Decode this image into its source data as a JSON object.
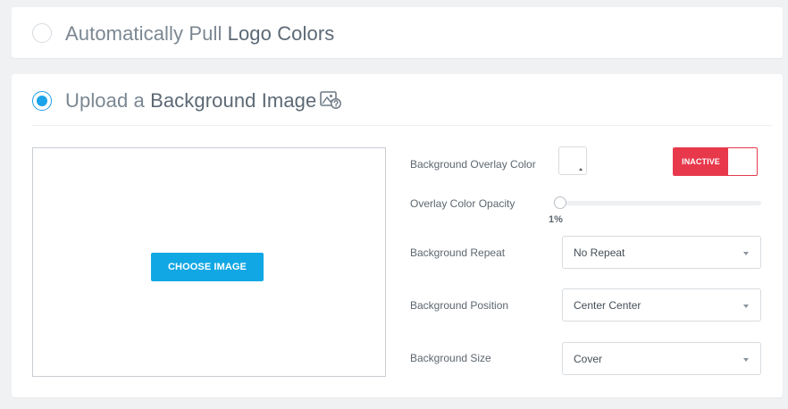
{
  "auto_pull": {
    "label_prefix": "Automatically Pull ",
    "label_bold": "Logo Colors",
    "selected": false
  },
  "upload": {
    "label_prefix": "Upload a ",
    "label_bold": "Background Image",
    "selected": true,
    "icon": "image-help-icon",
    "choose_button": "CHOOSE IMAGE"
  },
  "settings": {
    "overlay_color_label": "Background Overlay Color",
    "overlay_toggle_state": "INACTIVE",
    "opacity_label": "Overlay Color Opacity",
    "opacity_value": "1%",
    "opacity_fraction": 0.01,
    "repeat_label": "Background Repeat",
    "repeat_value": "No Repeat",
    "position_label": "Background Position",
    "position_value": "Center Center",
    "size_label": "Background Size",
    "size_value": "Cover"
  },
  "colors": {
    "accent_blue": "#11a7e4",
    "inactive_red": "#e8384b"
  }
}
